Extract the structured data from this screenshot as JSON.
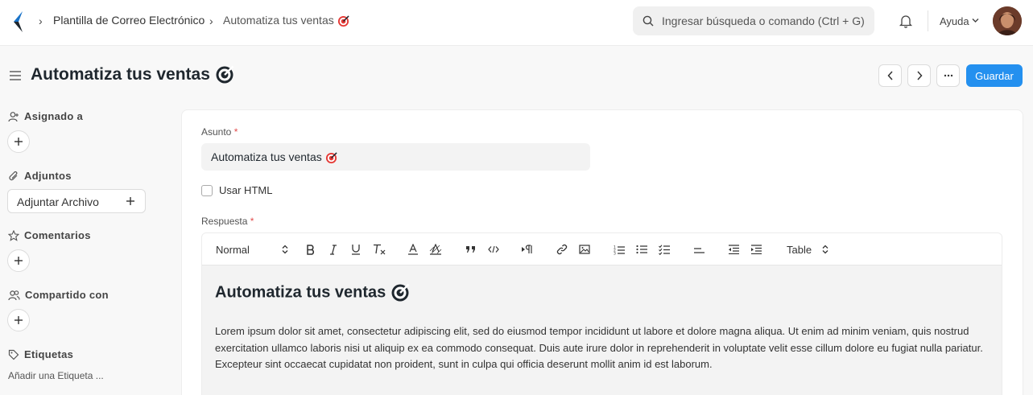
{
  "breadcrumb": {
    "items": [
      "Plantilla de Correo Electrónico",
      "Automatiza tus ventas"
    ]
  },
  "search": {
    "placeholder": "Ingresar búsqueda o comando (Ctrl + G)"
  },
  "help": {
    "label": "Ayuda"
  },
  "page": {
    "title": "Automatiza tus ventas"
  },
  "actions": {
    "save_label": "Guardar"
  },
  "sidebar": {
    "assigned_label": "Asignado a",
    "attachments_label": "Adjuntos",
    "attach_button": "Adjuntar Archivo",
    "comments_label": "Comentarios",
    "shared_label": "Compartido con",
    "tags_label": "Etiquetas",
    "add_tag": "Añadir una Etiqueta ..."
  },
  "form": {
    "subject_label": "Asunto",
    "subject_value": "Automatiza tus ventas",
    "use_html_label": "Usar HTML",
    "use_html_checked": false,
    "response_label": "Respuesta",
    "required_mark": "*"
  },
  "editor": {
    "format_select": "Normal",
    "table_select": "Table",
    "heading": "Automatiza tus ventas",
    "body": "Lorem ipsum dolor sit amet, consectetur adipiscing elit, sed do eiusmod tempor incididunt ut labore et dolore magna aliqua. Ut enim ad minim veniam, quis nostrud exercitation ullamco laboris nisi ut aliquip ex ea commodo consequat. Duis aute irure dolor in reprehenderit in voluptate velit esse cillum dolore eu fugiat nulla pariatur. Excepteur sint occaecat cupidatat non proident, sunt in culpa qui officia deserunt mollit anim id est laborum."
  },
  "colors": {
    "accent": "#2490ef",
    "required": "#e24c4c"
  }
}
